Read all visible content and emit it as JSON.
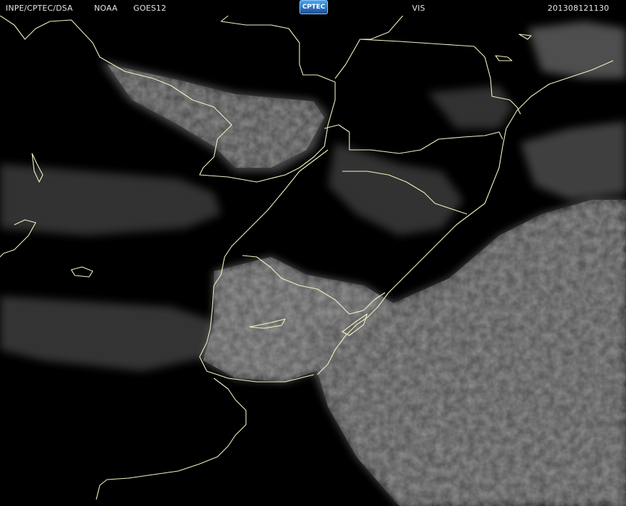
{
  "header": {
    "agency": "INPE/CPTEC/DSA",
    "source": "NOAA",
    "satellite": "GOES12",
    "logo_text": "CPTEC",
    "channel": "VIS",
    "timestamp": "201308121130"
  },
  "colors": {
    "background": "#000000",
    "header_text": "#e6e6e6",
    "border_lines": "#f4f1c4",
    "cloud_gray": "#7c7c7c",
    "logo_blue": "#2f7fd6"
  }
}
